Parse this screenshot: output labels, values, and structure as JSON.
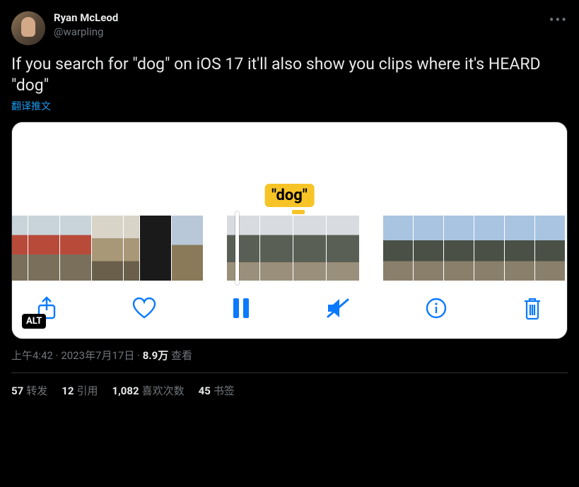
{
  "user": {
    "display_name": "Ryan McLeod",
    "handle": "@warpling"
  },
  "tweet_text": "If you search for \"dog\" on iOS 17 it'll also show you clips where it's HEARD \"dog\"",
  "translate_label": "翻译推文",
  "media": {
    "bubble_text": "\"dog\"",
    "alt_badge": "ALT"
  },
  "meta": {
    "time": "上午4:42",
    "date": "2023年7月17日",
    "views_count": "8.9万",
    "views_label": "查看",
    "separator": " · "
  },
  "stats": {
    "retweets_count": "57",
    "retweets_label": "转发",
    "quotes_count": "12",
    "quotes_label": "引用",
    "likes_count": "1,082",
    "likes_label": "喜欢次数",
    "bookmarks_count": "45",
    "bookmarks_label": "书签"
  }
}
